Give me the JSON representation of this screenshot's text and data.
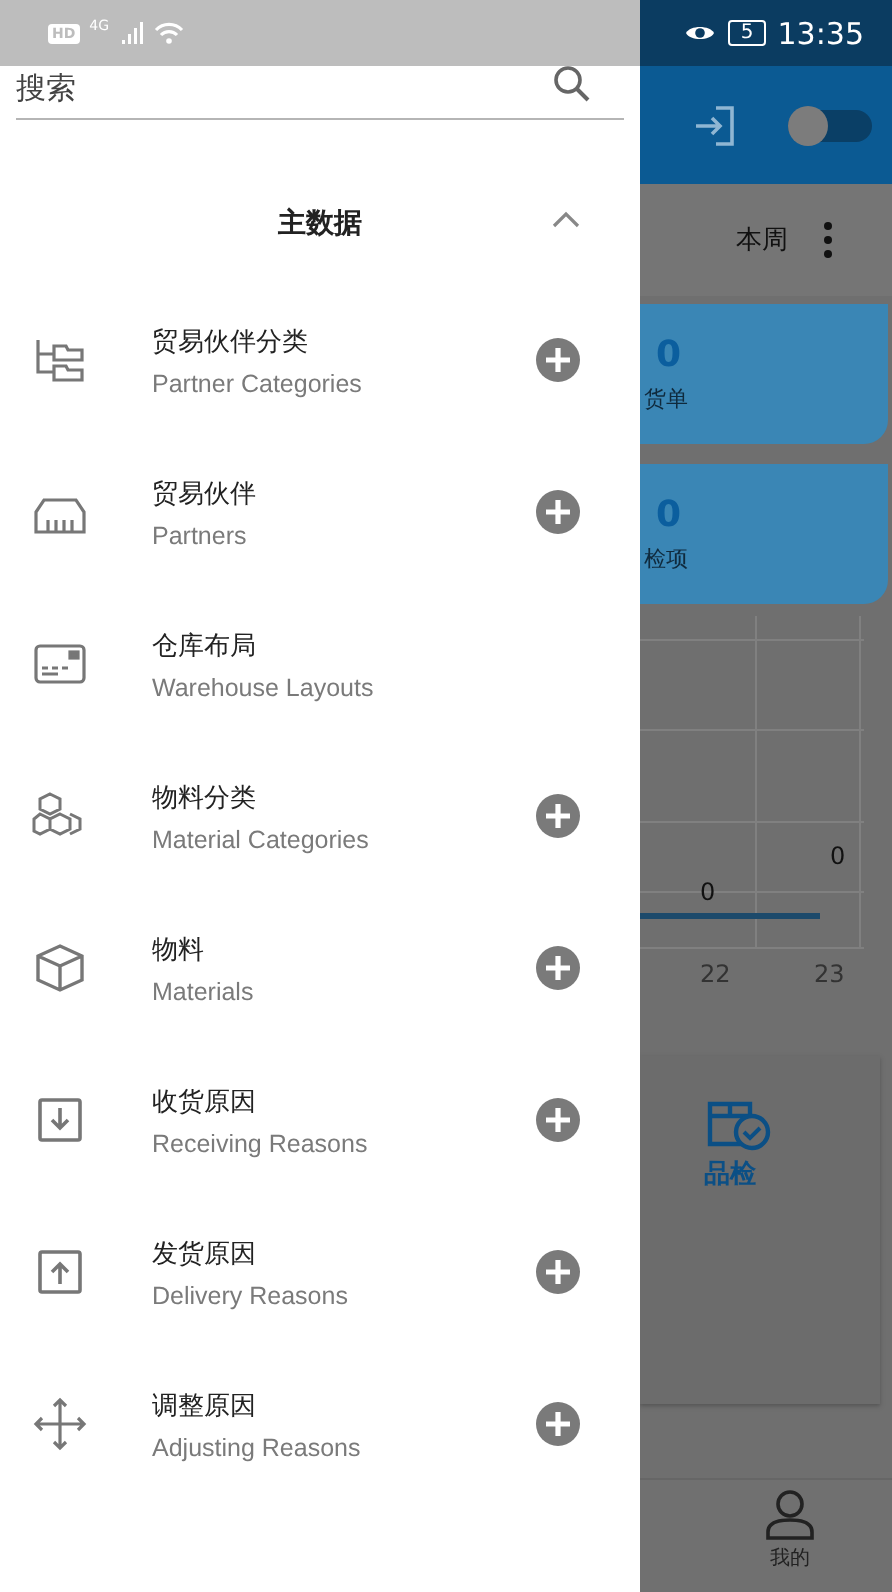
{
  "status_bar": {
    "hd_label": "HD",
    "network_label": "4G",
    "battery": "5",
    "time": "13:35"
  },
  "drawer": {
    "search": {
      "placeholder": "搜索"
    },
    "section": {
      "title": "主数据",
      "expanded": true,
      "items": [
        {
          "title": "贸易伙伴分类",
          "subtitle": "Partner Categories",
          "addable": true
        },
        {
          "title": "贸易伙伴",
          "subtitle": "Partners",
          "addable": true
        },
        {
          "title": "仓库布局",
          "subtitle": "Warehouse Layouts",
          "addable": false
        },
        {
          "title": "物料分类",
          "subtitle": "Material Categories",
          "addable": true
        },
        {
          "title": "物料",
          "subtitle": "Materials",
          "addable": true
        },
        {
          "title": "收货原因",
          "subtitle": "Receiving Reasons",
          "addable": true
        },
        {
          "title": "发货原因",
          "subtitle": "Delivery Reasons",
          "addable": true
        },
        {
          "title": "调整原因",
          "subtitle": "Adjusting Reasons",
          "addable": true
        }
      ]
    }
  },
  "background": {
    "toggle_on": false,
    "period": "本周",
    "cards": [
      {
        "value": "0",
        "label": "货单"
      },
      {
        "value": "0",
        "label": "检项"
      }
    ],
    "chart": {
      "value_labels": [
        "0",
        "0"
      ],
      "x_labels": [
        "22",
        "23"
      ]
    },
    "module": {
      "label": "品检"
    },
    "nav": [
      {
        "label": "我的",
        "selected": false
      }
    ]
  }
}
